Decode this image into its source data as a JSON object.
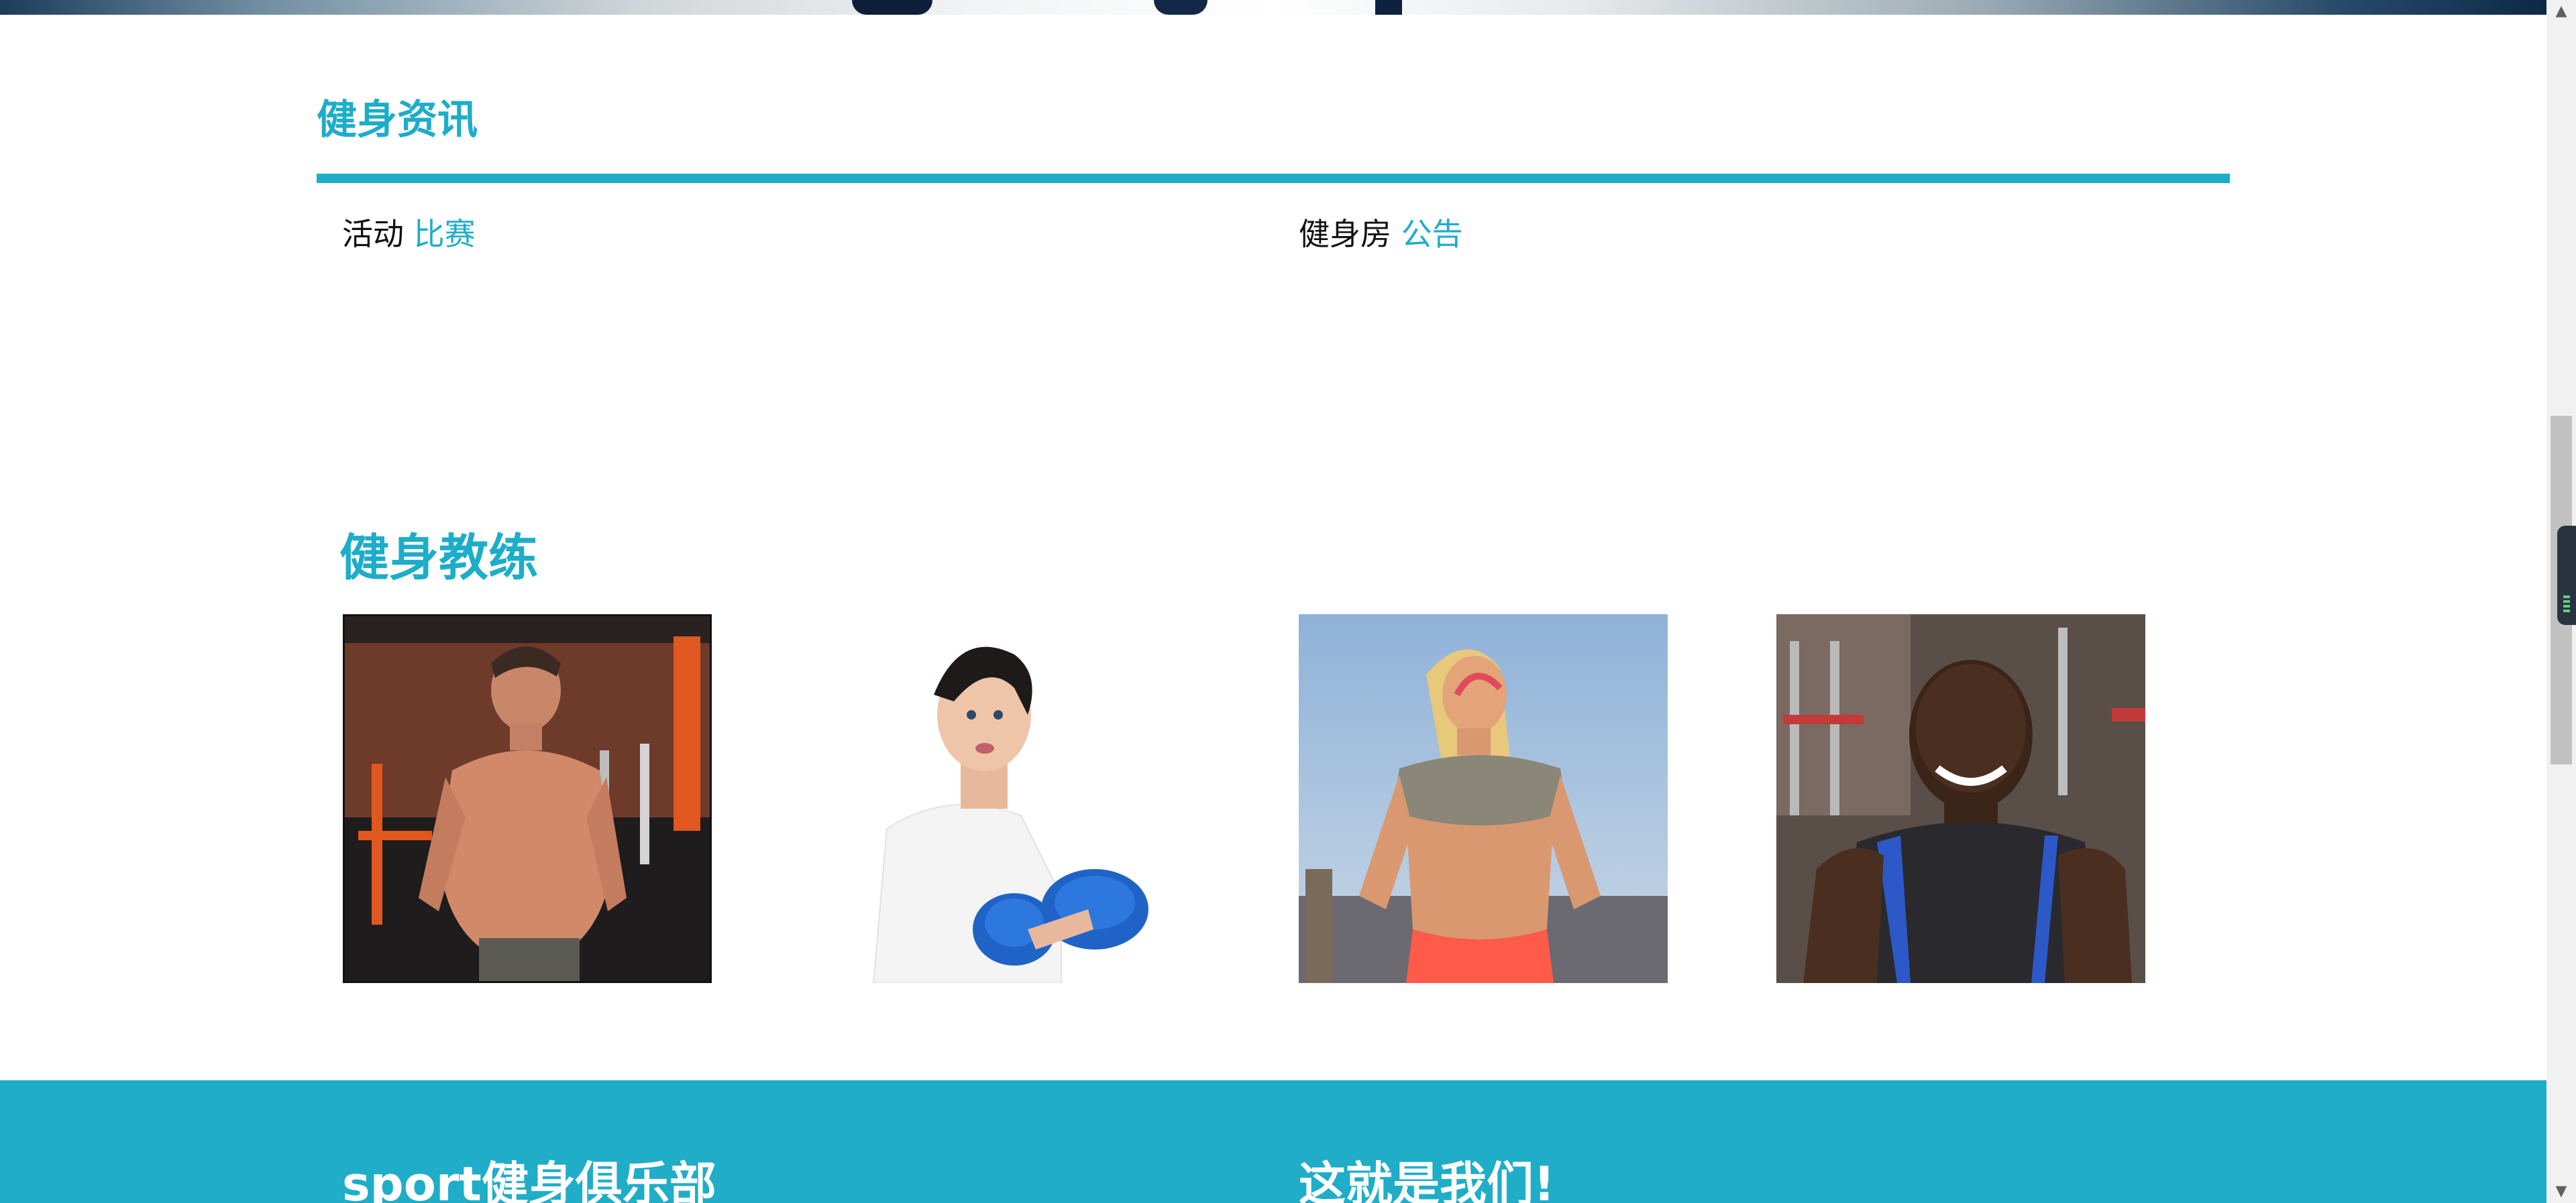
{
  "news": {
    "title": "健身资讯",
    "categories": [
      {
        "label": "活动",
        "highlight": "比赛"
      },
      {
        "label": "健身房",
        "highlight": "公告"
      }
    ]
  },
  "coaches": {
    "title": "健身教练"
  },
  "footer": {
    "col1_title": "sport健身俱乐部",
    "col2_title": "这就是我们!"
  },
  "colors": {
    "accent": "#1dadc9",
    "footer_bg": "#1fadc7"
  }
}
